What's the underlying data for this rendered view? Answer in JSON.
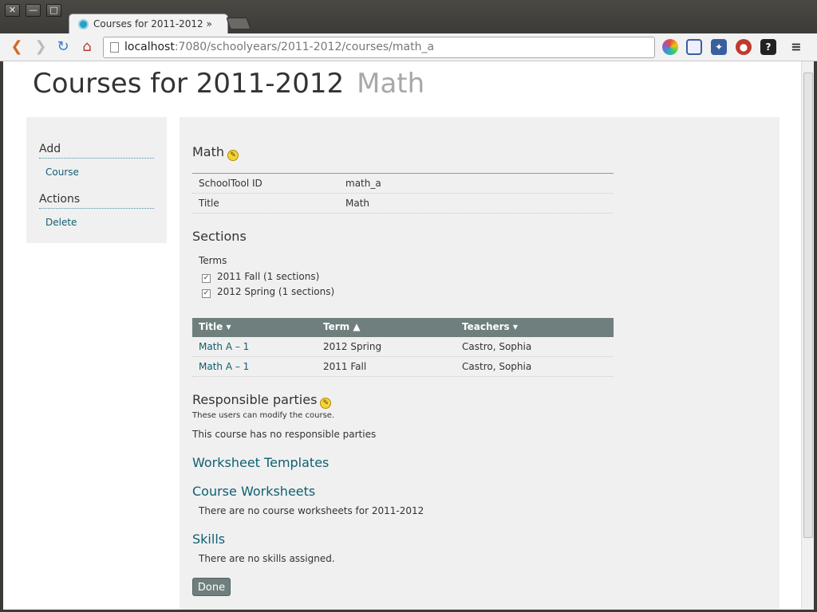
{
  "browser": {
    "tab_title": "Courses for 2011-2012 » ",
    "address_host": "localhost",
    "address_path": ":7080/schoolyears/2011-2012/courses/math_a"
  },
  "page": {
    "title": "Courses for 2011-2012",
    "subtitle": "Math"
  },
  "sidebar": {
    "add_heading": "Add",
    "add_course": "Course",
    "actions_heading": "Actions",
    "delete": "Delete"
  },
  "course": {
    "heading": "Math",
    "fields": [
      {
        "label": "SchoolTool ID",
        "value": "math_a"
      },
      {
        "label": "Title",
        "value": "Math"
      }
    ]
  },
  "sections": {
    "heading": "Sections",
    "terms_label": "Terms",
    "terms": [
      {
        "label": "2011 Fall (1 sections)",
        "checked": true
      },
      {
        "label": "2012 Spring (1 sections)",
        "checked": true
      }
    ],
    "columns": [
      "Title ▾",
      "Term ▲",
      "Teachers ▾"
    ],
    "rows": [
      {
        "title": "Math A – 1",
        "term": "2012 Spring",
        "teachers": "Castro, Sophia"
      },
      {
        "title": "Math A – 1",
        "term": "2011 Fall",
        "teachers": "Castro, Sophia"
      }
    ]
  },
  "responsible": {
    "heading": "Responsible parties",
    "note": "These users can modify the course.",
    "empty": "This course has no responsible parties"
  },
  "worksheet_templates": {
    "heading": "Worksheet Templates"
  },
  "course_worksheets": {
    "heading": "Course Worksheets",
    "empty": "There are no course worksheets for 2011-2012"
  },
  "skills": {
    "heading": "Skills",
    "empty": "There are no skills assigned."
  },
  "done_label": "Done"
}
